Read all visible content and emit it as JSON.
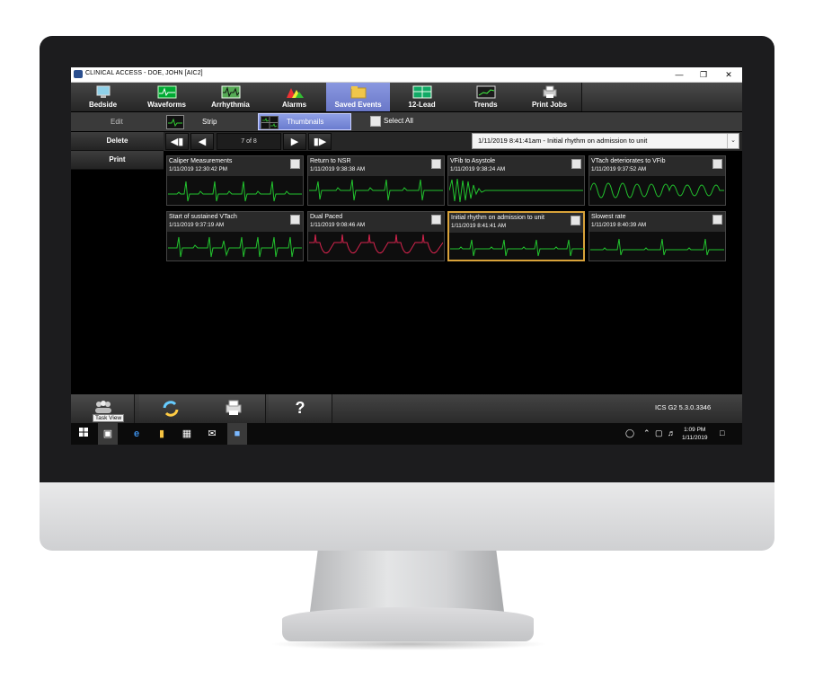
{
  "window": {
    "title": "CLINICAL ACCESS - DOE, JOHN [AIC2]"
  },
  "toolbar": {
    "items": [
      {
        "label": "Bedside",
        "icon": "monitor-icon"
      },
      {
        "label": "Waveforms",
        "icon": "waveforms-icon"
      },
      {
        "label": "Arrhythmia",
        "icon": "arrhythmia-icon"
      },
      {
        "label": "Alarms",
        "icon": "alarms-icon"
      },
      {
        "label": "Saved Events",
        "icon": "folder-icon"
      },
      {
        "label": "12-Lead",
        "icon": "twelve-lead-icon"
      },
      {
        "label": "Trends",
        "icon": "trends-icon"
      },
      {
        "label": "Print Jobs",
        "icon": "printer-icon"
      }
    ],
    "selected": "Saved Events"
  },
  "viewbar": {
    "edit_label": "Edit",
    "strip_label": "Strip",
    "thumbnails_label": "Thumbnails",
    "select_all_label": "Select All"
  },
  "sidebar": {
    "delete_label": "Delete",
    "print_label": "Print"
  },
  "nav": {
    "page_label": "7 of 8",
    "first": "first-page",
    "prev": "previous-page",
    "next": "next-page",
    "last": "last-page",
    "selected_event": "1/11/2019 8:41:41am - Initial rhythm on admission to unit"
  },
  "events": [
    {
      "title": "Caliper Measurements",
      "time": "1/11/2019 12:30:42 PM",
      "color": "#22c32e",
      "selected": false
    },
    {
      "title": "Return to NSR",
      "time": "1/11/2019 9:38:38 AM",
      "color": "#22c32e",
      "selected": false
    },
    {
      "title": "VFib to Asystole",
      "time": "1/11/2019 9:38:24 AM",
      "color": "#22c32e",
      "selected": false
    },
    {
      "title": "VTach deteriorates to VFib",
      "time": "1/11/2019 9:37:52 AM",
      "color": "#22c32e",
      "selected": false
    },
    {
      "title": "Start of sustained VTach",
      "time": "1/11/2019 9:37:19 AM",
      "color": "#22c32e",
      "selected": false
    },
    {
      "title": "Dual Paced",
      "time": "1/11/2019 9:08:46 AM",
      "color": "#d8244e",
      "selected": false
    },
    {
      "title": "Initial rhythm on admission to unit",
      "time": "1/11/2019 8:41:41 AM",
      "color": "#22c32e",
      "selected": true
    },
    {
      "title": "Slowest rate",
      "time": "1/11/2019 8:40:39 AM",
      "color": "#22c32e",
      "selected": false
    }
  ],
  "bottombar": {
    "buttons": [
      "task-view",
      "switch",
      "print",
      "help"
    ],
    "help_glyph": "?",
    "tooltip": "Task View",
    "version": "ICS G2 5.3.0.3346"
  },
  "taskbar": {
    "time": "1:09 PM",
    "date": "1/11/2019"
  }
}
